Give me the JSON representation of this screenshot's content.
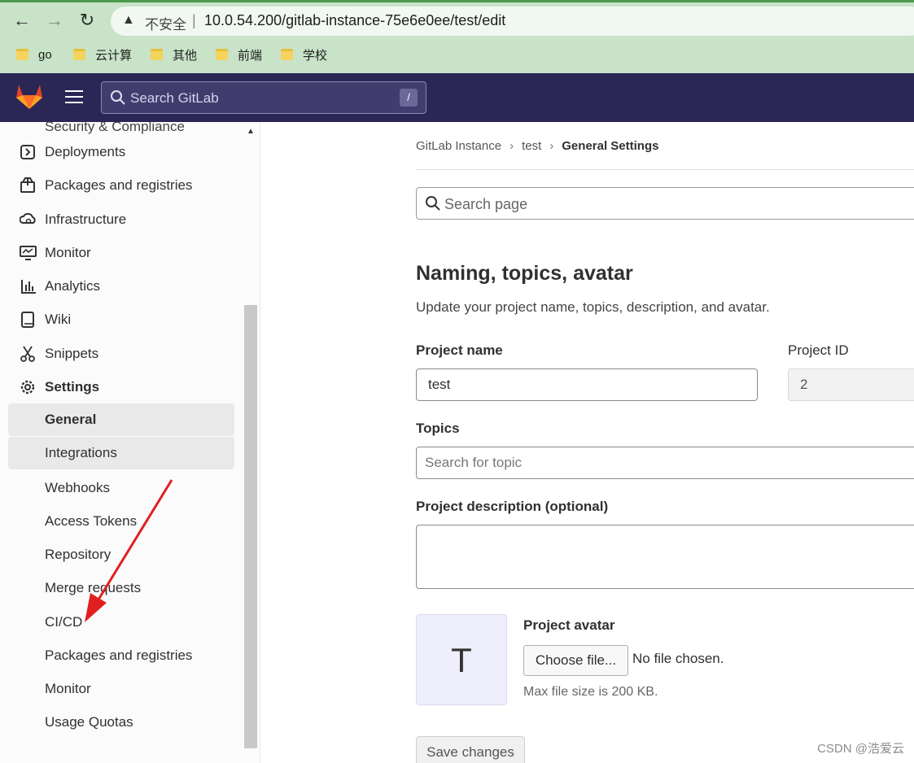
{
  "browser": {
    "insecure_label": "不安全",
    "separator": "|",
    "url": "10.0.54.200/gitlab-instance-75e6e0ee/test/edit",
    "bookmarks": [
      "go",
      "云计算",
      "其他",
      "前端",
      "学校"
    ]
  },
  "topnav": {
    "search_placeholder": "Search GitLab",
    "search_shortcut": "/"
  },
  "sidebar": {
    "partial_top_item": "Security & Compliance",
    "items": [
      {
        "label": "Deployments",
        "icon": "deployments-icon"
      },
      {
        "label": "Packages and registries",
        "icon": "package-icon"
      },
      {
        "label": "Infrastructure",
        "icon": "cloud-gear-icon"
      },
      {
        "label": "Monitor",
        "icon": "monitor-icon"
      },
      {
        "label": "Analytics",
        "icon": "chart-icon"
      },
      {
        "label": "Wiki",
        "icon": "book-icon"
      },
      {
        "label": "Snippets",
        "icon": "scissors-icon"
      },
      {
        "label": "Settings",
        "icon": "gear-icon"
      }
    ],
    "settings_sub": [
      "General",
      "Integrations",
      "Webhooks",
      "Access Tokens",
      "Repository",
      "Merge requests",
      "CI/CD",
      "Packages and registries",
      "Monitor",
      "Usage Quotas"
    ]
  },
  "breadcrumb": {
    "items": [
      "GitLab Instance",
      "test"
    ],
    "current": "General Settings"
  },
  "page_search_placeholder": "Search page",
  "section": {
    "title": "Naming, topics, avatar",
    "description": "Update your project name, topics, description, and avatar."
  },
  "form": {
    "project_name_label": "Project name",
    "project_name_value": "test",
    "project_id_label": "Project ID",
    "project_id_value": "2",
    "topics_label": "Topics",
    "topics_placeholder": "Search for topic",
    "description_label": "Project description (optional)",
    "avatar_label": "Project avatar",
    "avatar_letter": "T",
    "choose_file": "Choose file...",
    "no_file": "No file chosen.",
    "max_size": "Max file size is 200 KB.",
    "save": "Save changes"
  },
  "watermark": "CSDN @浩爱云",
  "colors": {
    "gitlab_nav": "#2a2757",
    "annotation_arrow": "#e02020"
  }
}
